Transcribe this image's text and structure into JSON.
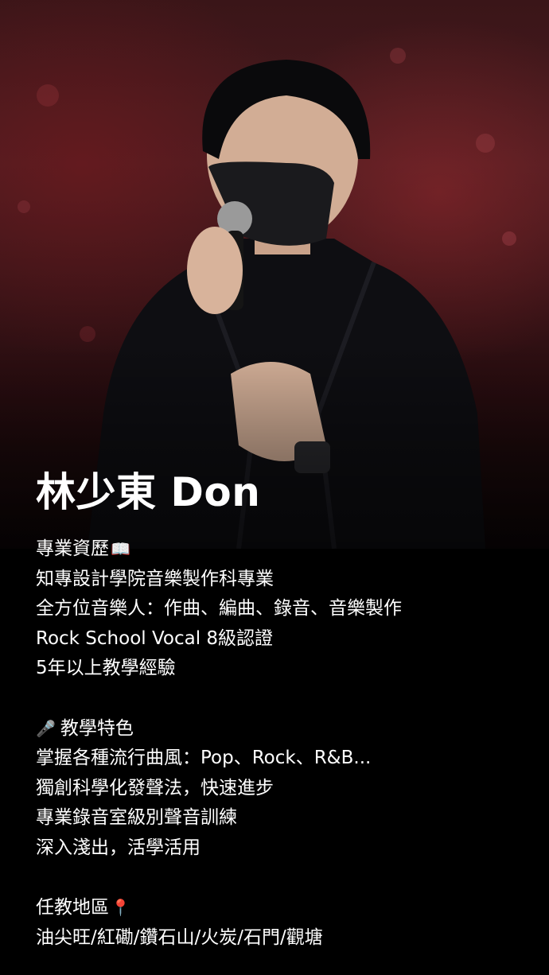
{
  "profile": {
    "name": "林少東 Don"
  },
  "sections": [
    {
      "heading": "專業資歷",
      "icon": "open-book-icon",
      "icon_glyph": "📖",
      "items": [
        "知專設計學院音樂製作科專業",
        "全方位音樂人：作曲、編曲、錄音、音樂製作",
        "Rock School Vocal 8級認證",
        "5年以上教學經驗"
      ]
    },
    {
      "heading": "教學特色",
      "icon": "microphone-music-icon",
      "icon_glyph": "🎤",
      "items": [
        "掌握各種流行曲風：Pop、Rock、R&B...",
        "獨創科學化發聲法，快速進步",
        "專業錄音室級別聲音訓練",
        "深入淺出，活學活用"
      ]
    },
    {
      "heading": "任教地區",
      "icon": "location-pin-icon",
      "icon_glyph": "📍",
      "items": [
        "油尖旺/紅磡/鑽石山/火炭/石門/觀塘"
      ]
    }
  ],
  "colors": {
    "background": "#000000",
    "text": "#ffffff",
    "stage_red": "#4a1c20"
  }
}
